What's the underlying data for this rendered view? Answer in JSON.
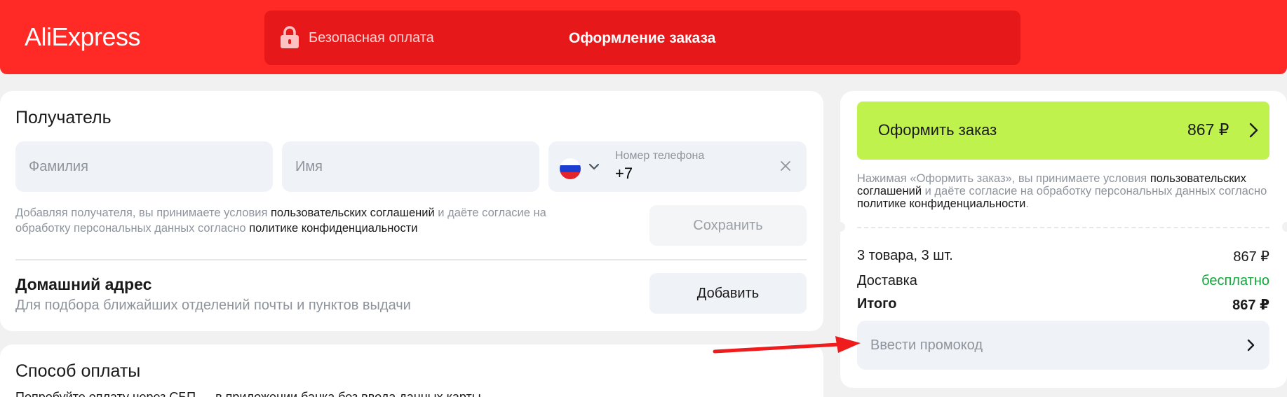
{
  "header": {
    "logo": "AliExpress",
    "secure_payment": "Безопасная оплата",
    "checkout_title": "Оформление заказа"
  },
  "recipient": {
    "title": "Получатель",
    "last_name_placeholder": "Фамилия",
    "first_name_placeholder": "Имя",
    "phone_label": "Номер телефона",
    "phone_value": "+7",
    "consent_text_1": "Добавляя получателя, вы принимаете условия ",
    "consent_link_1": "пользовательских соглашений",
    "consent_text_2": " и даёте согласие на обработку персональных данных согласно ",
    "consent_link_2": "политике конфиденциальности",
    "save_label": "Сохранить"
  },
  "address": {
    "title": "Домашний адрес",
    "subtitle": "Для подбора ближайших отделений почты и пунктов выдачи",
    "add_label": "Добавить"
  },
  "payment": {
    "title": "Способ оплаты",
    "subtitle": "Попробуйте оплату через СБП — в приложении банка без ввода данных карты"
  },
  "summary": {
    "order_button_label": "Оформить заказ",
    "order_button_price": "867 ₽",
    "terms_text_1": "Нажимая «Оформить заказ», вы принимаете условия ",
    "terms_link_1": "пользовательских соглашений",
    "terms_text_2": " и даёте согласие на обработку персональных данных согласно ",
    "terms_link_2": "политике конфиденциальности",
    "terms_text_3": ".",
    "items_label": "3 товара, 3 шт.",
    "items_value": "867 ₽",
    "delivery_label": "Доставка",
    "delivery_value": "бесплатно",
    "total_label": "Итого",
    "total_value": "867 ₽",
    "promo_placeholder": "Ввести промокод"
  },
  "colors": {
    "brand_red": "#ff2a26",
    "order_green": "#c0f24d",
    "free_green": "#12a63a"
  }
}
